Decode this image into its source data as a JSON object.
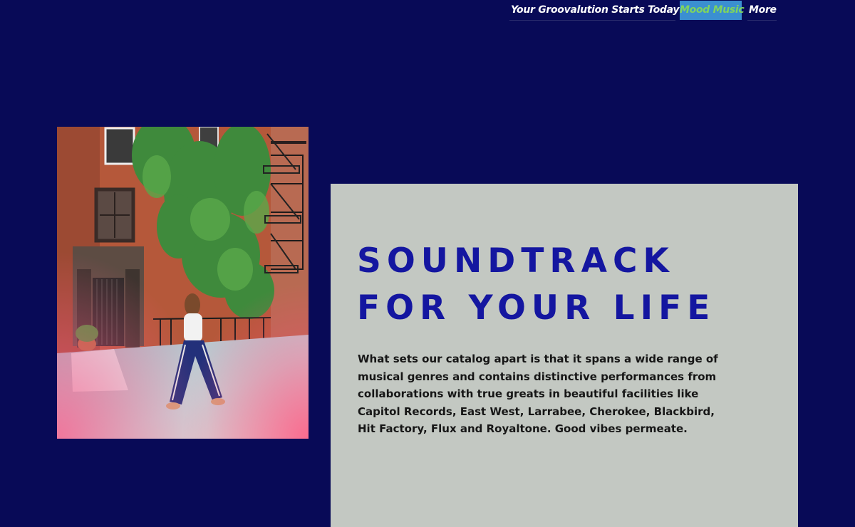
{
  "nav": {
    "items": [
      {
        "label": "Your Groovalution Starts Today"
      },
      {
        "label": "Mood Music"
      },
      {
        "label": "More"
      }
    ]
  },
  "hero": {
    "image_alt": "Woman in striped track pants walking past a red-brick townhouse covered in ivy",
    "headline_line1": "SOUNDTRACK",
    "headline_line2": "FOR YOUR LIFE",
    "body": "What sets our catalog apart is that it spans a wide range of musical genres and contains distinctive performances from collaborations with true greats in beautiful facilities like Capitol Records, East West, Larrabee, Cherokee, Blackbird, Hit Factory, Flux and Royaltone. Good vibes permeate."
  },
  "colors": {
    "background": "#080a57",
    "card": "#c3c8c2",
    "headline": "#1416a0",
    "nav_active_bg": "#3b8fd1",
    "nav_active_text": "#7fd45f"
  }
}
